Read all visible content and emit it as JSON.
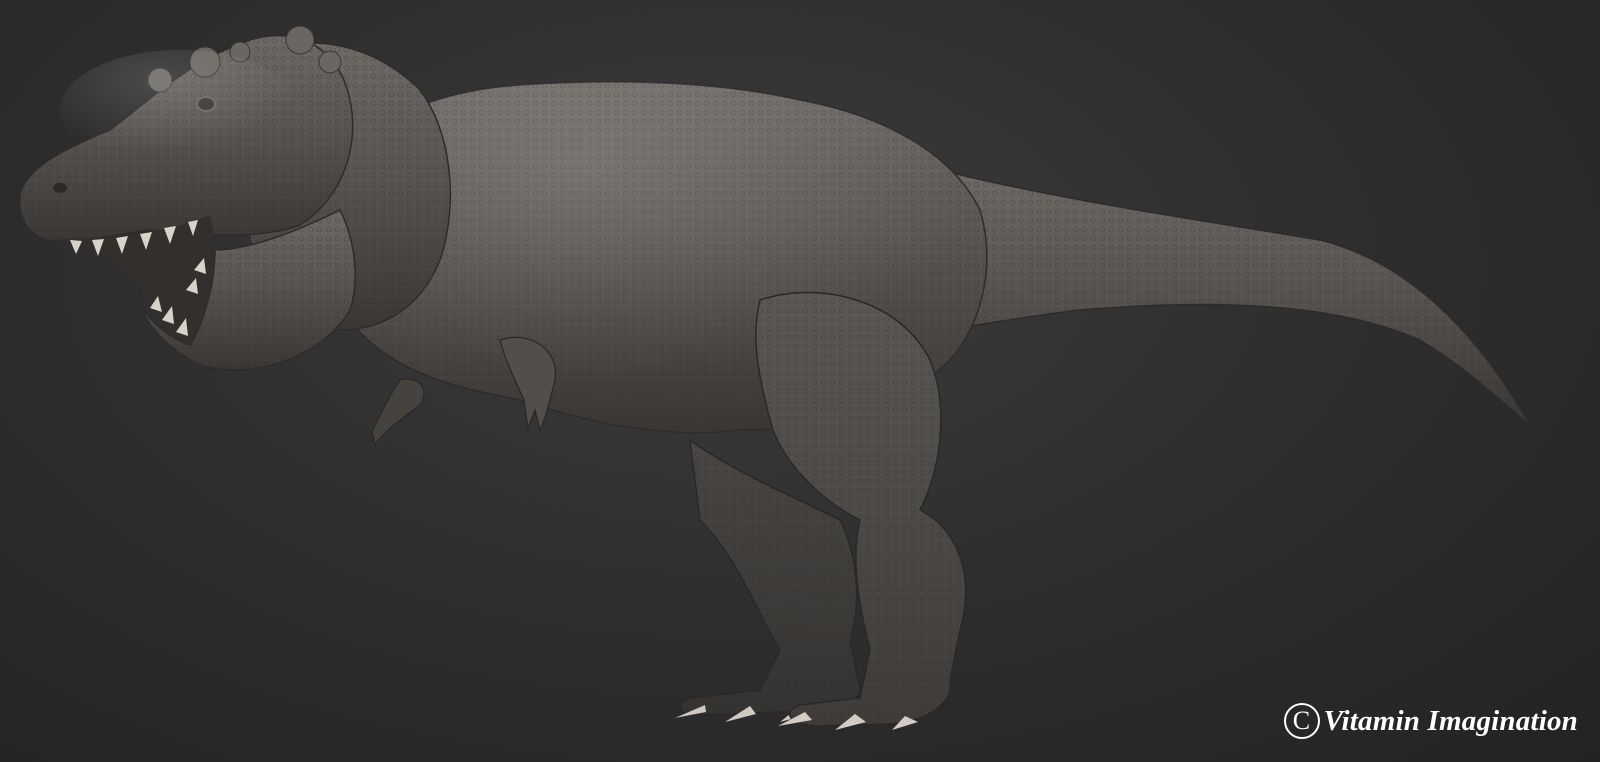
{
  "image": {
    "subject": "tyrannosaurus-rex-sculpt",
    "background_color": "#2f2f2f",
    "model_color": "#5a5754"
  },
  "watermark": {
    "symbol": "C",
    "text": "Vitamin Imagination",
    "color": "#ffffff"
  }
}
